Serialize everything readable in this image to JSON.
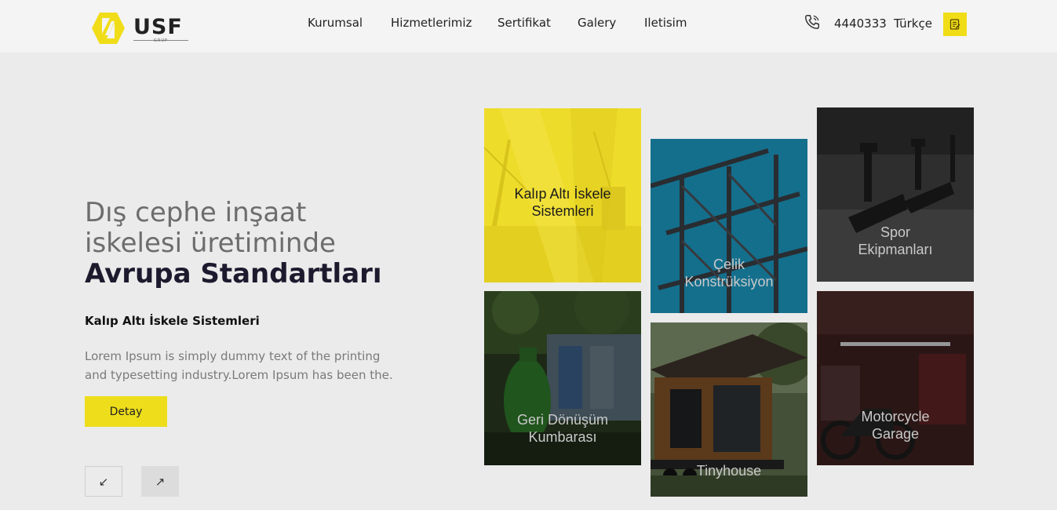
{
  "brand": {
    "name": "USF",
    "sub": "GRUP",
    "accent": "#f0dd18"
  },
  "nav": {
    "items": [
      {
        "label": "Kurumsal"
      },
      {
        "label": "Hizmetlerimiz"
      },
      {
        "label": "Sertifikat"
      },
      {
        "label": "Galery"
      },
      {
        "label": "Iletisim"
      }
    ]
  },
  "header": {
    "phone": "4440333",
    "language": "Türkçe",
    "icons": {
      "phone": "phone-icon",
      "note": "note-icon"
    }
  },
  "hero": {
    "line1": "Dış cephe inşaat",
    "line2": "iskelesi üretiminde",
    "line3": "Avrupa Standartları",
    "subtitle": "Kalıp Altı İskele Sistemleri",
    "description": "Lorem Ipsum is simply dummy text of the printing and typesetting industry.Lorem Ipsum has been the.",
    "cta": "Detay",
    "prev_arrow": "↙",
    "next_arrow": "↗"
  },
  "tiles": [
    {
      "line1": "Kalıp Altı İskele",
      "line2": "Sistemleri",
      "active": true
    },
    {
      "line1": "Geri Dönüşüm",
      "line2": "Kumbarası"
    },
    {
      "line1": "Çelik",
      "line2": "Konstrüksiyon"
    },
    {
      "line1": "Tinyhouse",
      "line2": ""
    },
    {
      "line1": "Spor",
      "line2": "Ekipmanları"
    },
    {
      "line1": "Motorcycle",
      "line2": "Garage"
    }
  ]
}
